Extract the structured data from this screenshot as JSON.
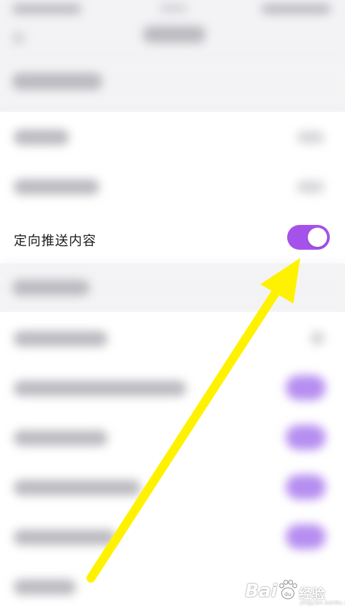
{
  "row": {
    "label": "定向推送内容",
    "toggle_on": true
  },
  "colors": {
    "toggle_accent": "#a552ea",
    "arrow": "#fff200"
  },
  "watermark": {
    "brand": "Bai",
    "paw": "du",
    "suffix": "经验",
    "url": "jingyan.baidu.com"
  }
}
